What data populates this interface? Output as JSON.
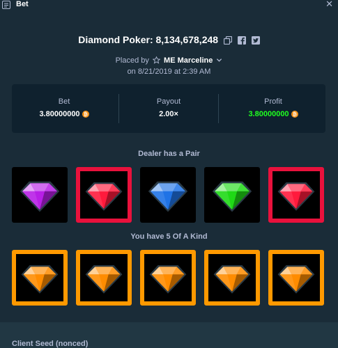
{
  "window": {
    "title": "Bet"
  },
  "bet": {
    "game": "Diamond Poker:",
    "id": "8,134,678,248",
    "placed_by_prefix": "Placed by",
    "username": "ME Marceline",
    "date_line": "on 8/21/2019 at 2:39 AM"
  },
  "stats": {
    "bet_label": "Bet",
    "bet_value": "3.80000000",
    "payout_label": "Payout",
    "payout_value": "2.00×",
    "profit_label": "Profit",
    "profit_value": "3.80000000"
  },
  "dealer": {
    "title": "Dealer has a Pair",
    "gems": [
      {
        "color": "purple",
        "highlighted": false
      },
      {
        "color": "red",
        "highlighted": true
      },
      {
        "color": "blue",
        "highlighted": false
      },
      {
        "color": "green",
        "highlighted": false
      },
      {
        "color": "red",
        "highlighted": true
      }
    ]
  },
  "player": {
    "title": "You have 5 Of A Kind",
    "gems": [
      {
        "color": "orange",
        "highlighted": true
      },
      {
        "color": "orange",
        "highlighted": true
      },
      {
        "color": "orange",
        "highlighted": true
      },
      {
        "color": "orange",
        "highlighted": true
      },
      {
        "color": "orange",
        "highlighted": true
      }
    ]
  },
  "client_seed_label": "Client Seed (nonced)",
  "icons": {
    "titlebar": "bet-slip-icon",
    "copy": "copy-icon",
    "facebook": "facebook-icon",
    "twitter": "twitter-icon",
    "star": "star-icon",
    "chevron": "chevron-down-icon",
    "coin": "bitcoin-coin-icon",
    "close": "close-icon"
  },
  "colors": {
    "background": "#1a2c38",
    "panel": "#0f212e",
    "red_highlight": "#e9113c",
    "orange_highlight": "#ff9900",
    "profit_green": "#1fff20",
    "gem_purple": "#b81fe6",
    "gem_red": "#ff1a3c",
    "gem_blue": "#1f73e6",
    "gem_green": "#1fd916",
    "gem_orange": "#ff8c00"
  }
}
